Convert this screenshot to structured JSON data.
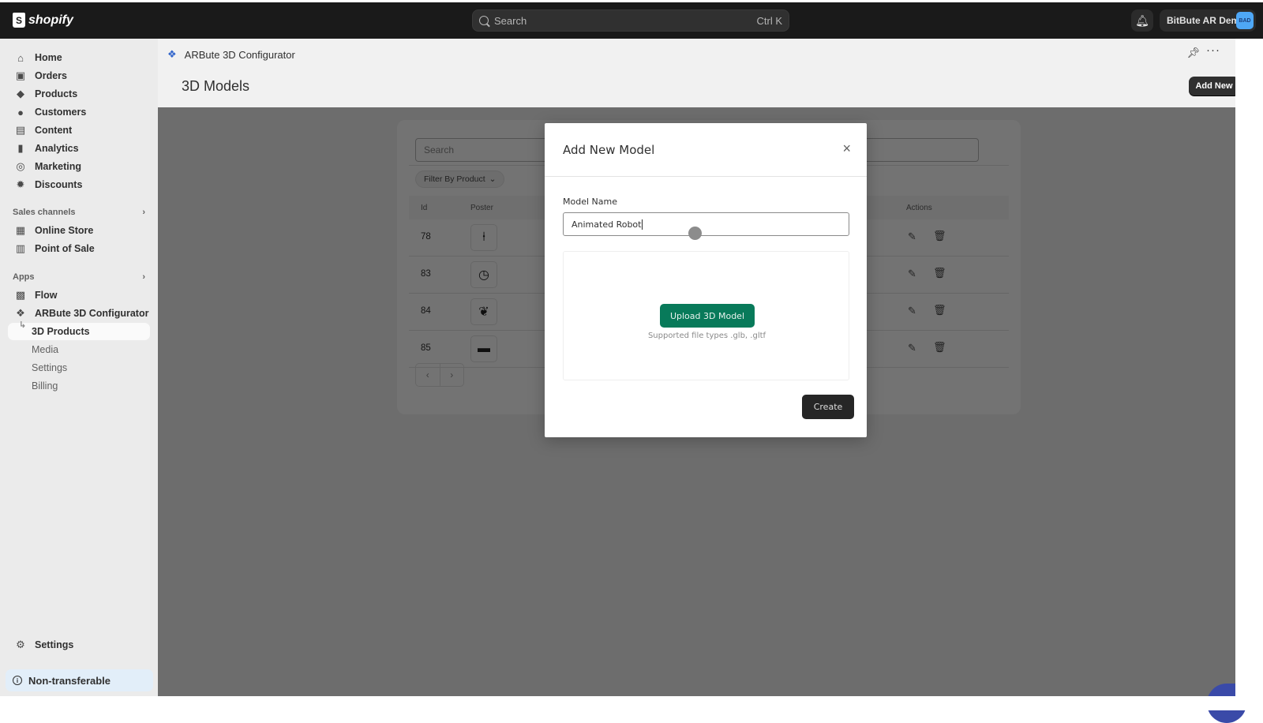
{
  "topbar": {
    "brand": "shopify",
    "search_placeholder": "Search",
    "search_shortcut": "Ctrl K",
    "store_name": "BitBute AR Demo",
    "store_avatar": "BAD"
  },
  "sidebar": {
    "items": [
      {
        "label": "Home",
        "icon": "home-icon"
      },
      {
        "label": "Orders",
        "icon": "inbox-icon"
      },
      {
        "label": "Products",
        "icon": "tag-icon"
      },
      {
        "label": "Customers",
        "icon": "person-icon"
      },
      {
        "label": "Content",
        "icon": "image-icon"
      },
      {
        "label": "Analytics",
        "icon": "bar-chart-icon"
      },
      {
        "label": "Marketing",
        "icon": "target-icon"
      },
      {
        "label": "Discounts",
        "icon": "discount-icon"
      }
    ],
    "sales_channels_label": "Sales channels",
    "sales_channels": [
      {
        "label": "Online Store",
        "icon": "store-icon"
      },
      {
        "label": "Point of Sale",
        "icon": "pos-icon"
      }
    ],
    "apps_label": "Apps",
    "apps": [
      {
        "label": "Flow",
        "icon": "flow-icon"
      },
      {
        "label": "ARBute 3D Configurator",
        "icon": "app-icon"
      }
    ],
    "app_subitems": [
      {
        "label": "3D Products",
        "active": true
      },
      {
        "label": "Media"
      },
      {
        "label": "Settings"
      },
      {
        "label": "Billing"
      }
    ],
    "settings_label": "Settings",
    "non_transferable_label": "Non-transferable"
  },
  "appbar": {
    "app_name": "ARBute 3D Configurator"
  },
  "page": {
    "title": "3D Models",
    "add_new_label": "Add New"
  },
  "table": {
    "search_placeholder": "Search",
    "filter_label": "Filter By Product",
    "columns": [
      "Id",
      "Poster",
      "Actions"
    ],
    "rows": [
      {
        "id": "78",
        "poster": "lamp"
      },
      {
        "id": "83",
        "poster": "clock"
      },
      {
        "id": "84",
        "poster": "slippers"
      },
      {
        "id": "85",
        "poster": "sofa"
      }
    ]
  },
  "modal": {
    "title": "Add New Model",
    "field_label": "Model Name",
    "field_value": "Animated Robot",
    "upload_label": "Upload 3D Model",
    "upload_hint": "Supported file types .glb, .gltf",
    "create_label": "Create"
  },
  "colors": {
    "topbar": "#1a1a1a",
    "upload_button": "#087a5a",
    "primary_button": "#303030",
    "chat_bubble": "#3a4aa8",
    "avatar": "#4ea7f6"
  }
}
